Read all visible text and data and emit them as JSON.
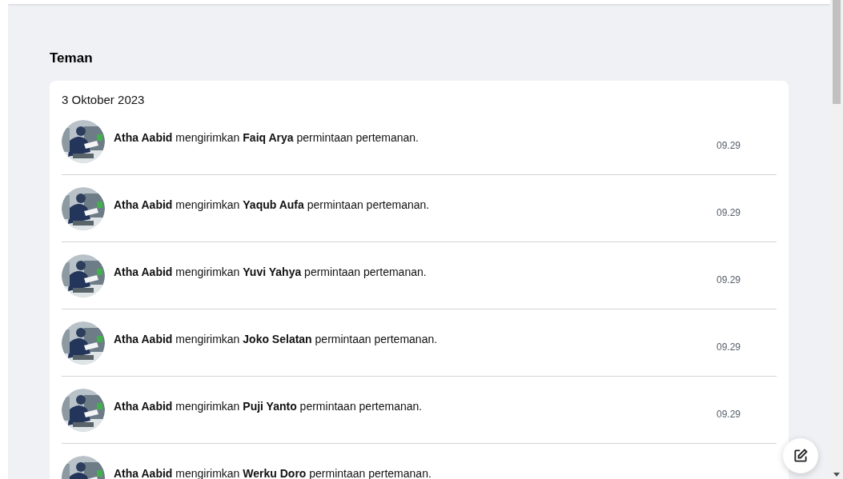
{
  "section_title": "Teman",
  "groups": [
    {
      "date": "3 Oktober 2023",
      "items": [
        {
          "text": "**Atha Aabid** mengirimkan **Faiq Arya** permintaan pertemanan.",
          "time": "09.29"
        },
        {
          "text": "**Atha Aabid** mengirimkan **Yaqub Aufa** permintaan pertemanan.",
          "time": "09.29"
        },
        {
          "text": "**Atha Aabid** mengirimkan **Yuvi Yahya** permintaan pertemanan.",
          "time": "09.29"
        },
        {
          "text": "**Atha Aabid** mengirimkan **Joko Selatan** permintaan pertemanan.",
          "time": "09.29"
        },
        {
          "text": "**Atha Aabid** mengirimkan **Puji Yanto** permintaan pertemanan.",
          "time": "09.29"
        },
        {
          "text": "**Atha Aabid** mengirimkan **Werku Doro** permintaan pertemanan."
        }
      ]
    }
  ]
}
